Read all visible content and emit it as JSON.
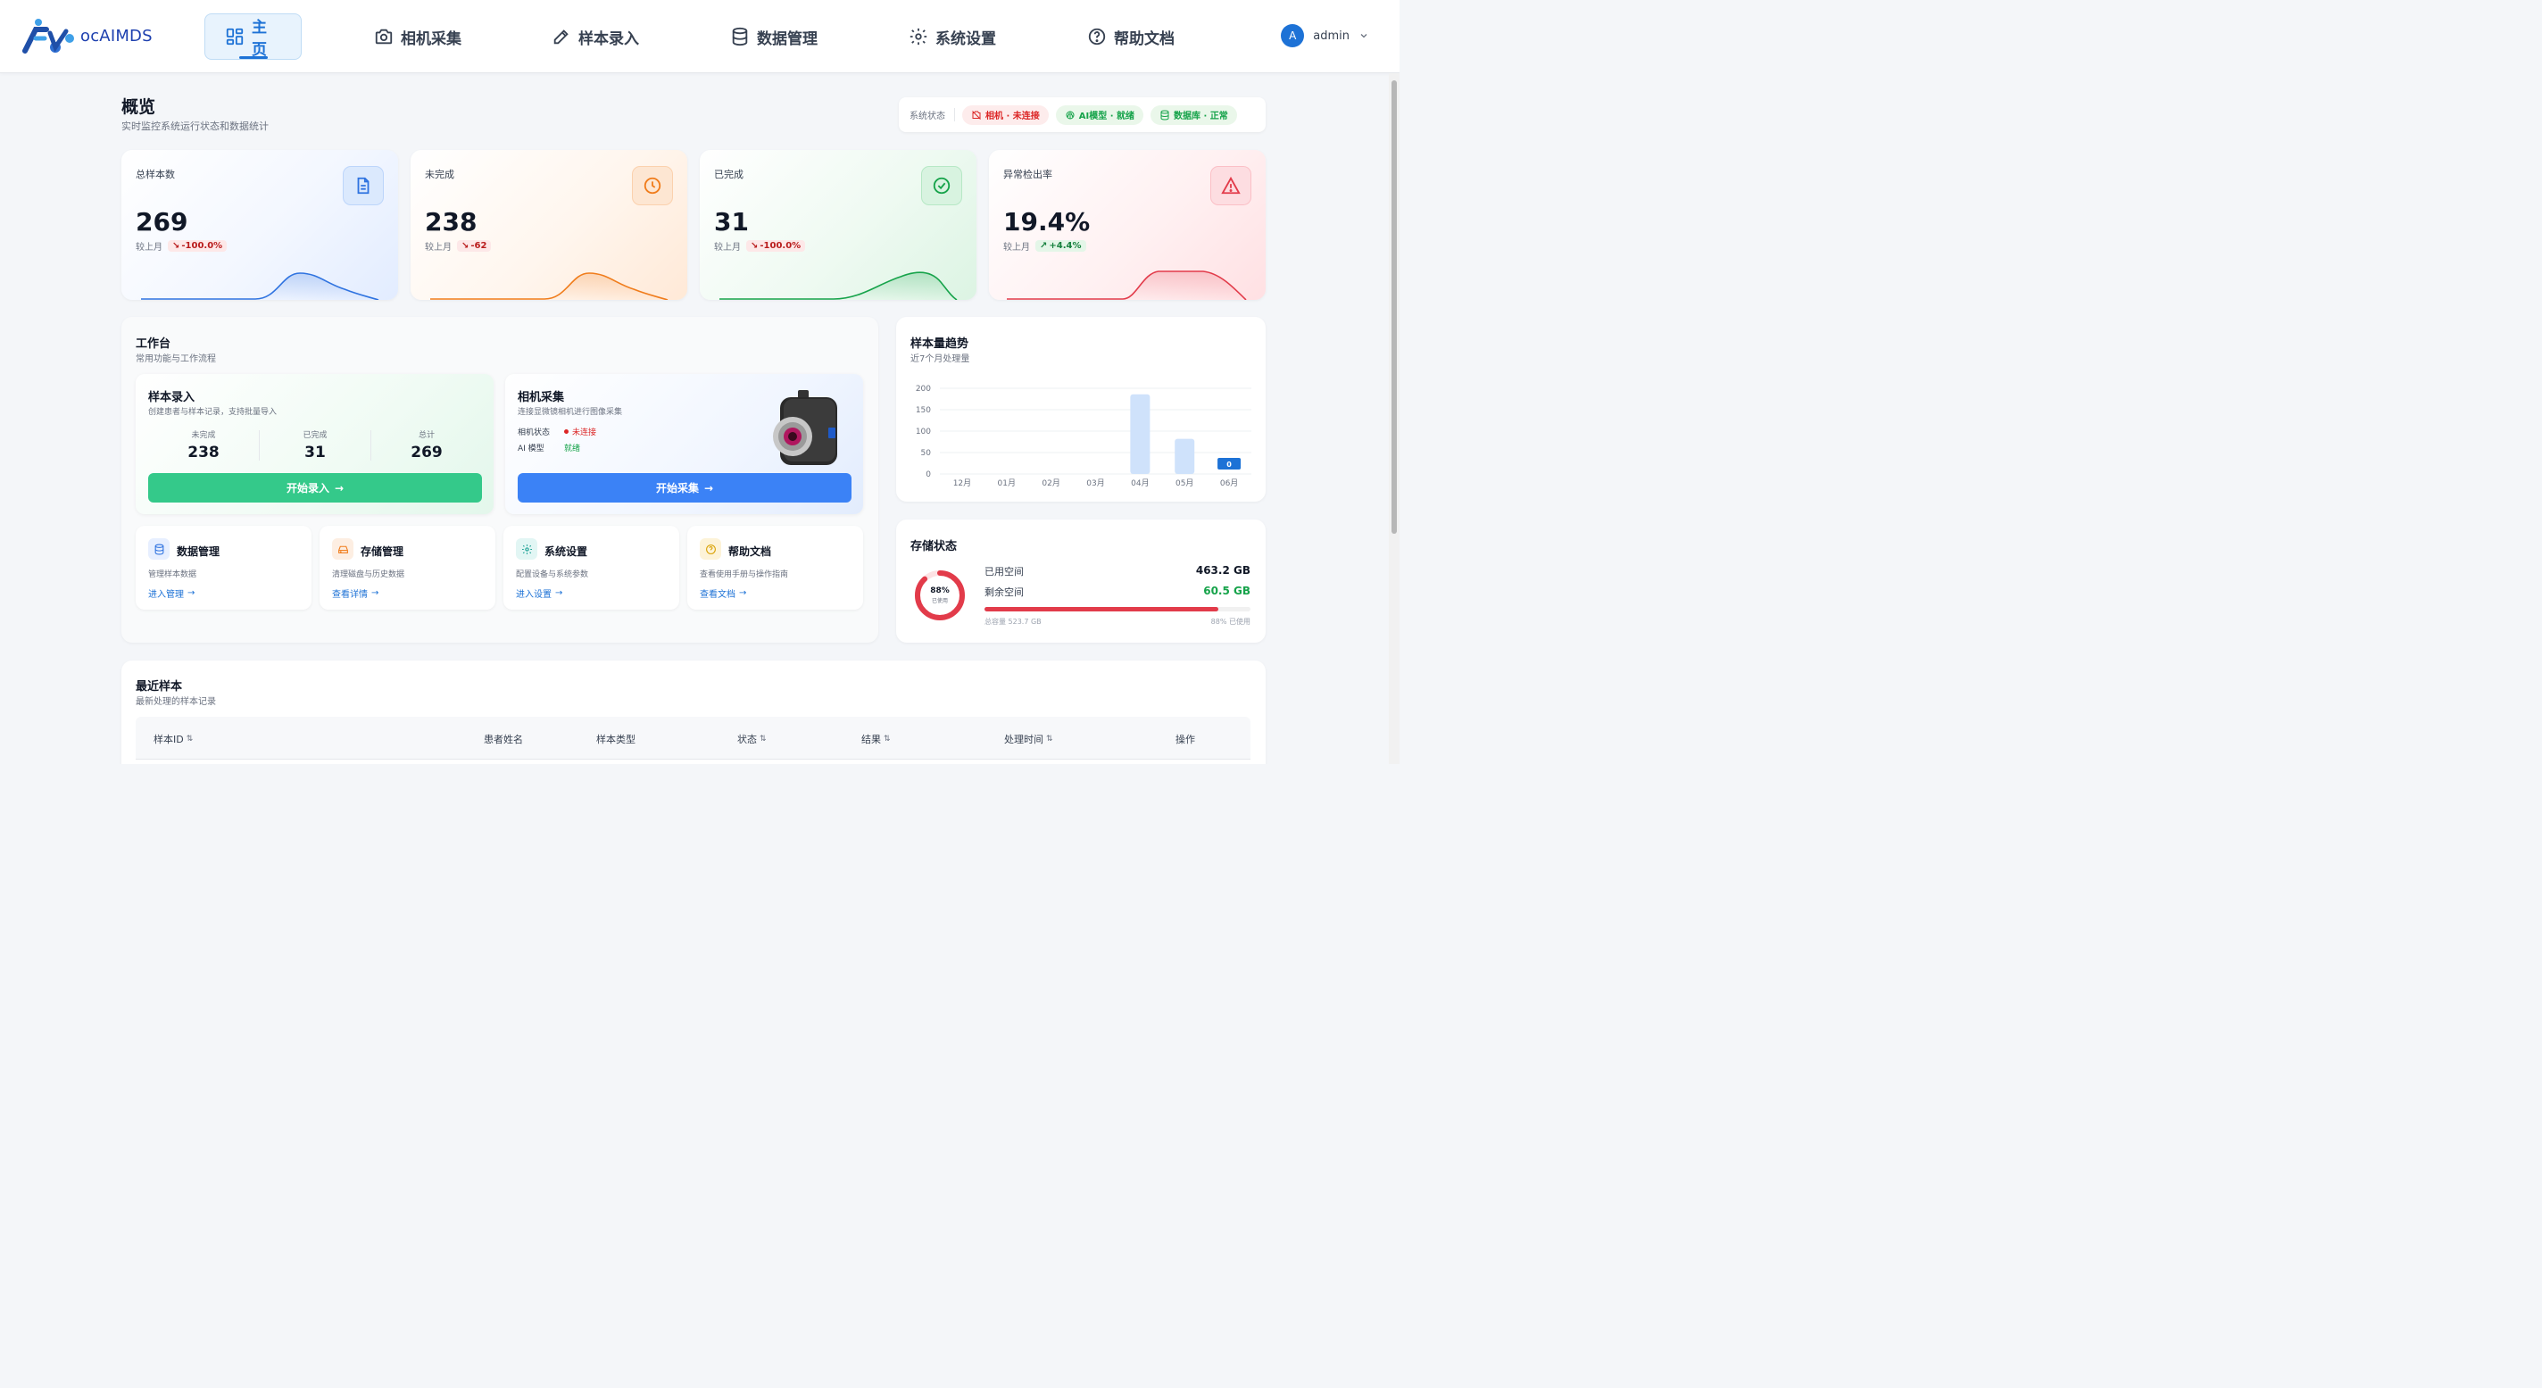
{
  "brand": {
    "logo_text": "ocAIMDS"
  },
  "nav": [
    {
      "label": "主页",
      "icon": "dashboard-icon",
      "active": true
    },
    {
      "label": "相机采集",
      "icon": "camera-icon",
      "active": false
    },
    {
      "label": "样本录入",
      "icon": "pen-icon",
      "active": false
    },
    {
      "label": "数据管理",
      "icon": "database-icon",
      "active": false
    },
    {
      "label": "系统设置",
      "icon": "gear-icon",
      "active": false
    },
    {
      "label": "帮助文档",
      "icon": "help-icon",
      "active": false
    }
  ],
  "user": {
    "avatar_letter": "A",
    "name": "admin"
  },
  "overview": {
    "title": "概览",
    "subtitle": "实时监控系统运行状态和数据统计"
  },
  "system_status": {
    "label": "系统状态",
    "camera": "相机 · 未连接",
    "ai": "AI模型 · 就绪",
    "db": "数据库 · 正常"
  },
  "stats": [
    {
      "label": "总样本数",
      "value": "269",
      "compare": "较上月",
      "trend": "-100.0%",
      "direction": "down",
      "color": "#2f73e0",
      "icon": "document-icon"
    },
    {
      "label": "未完成",
      "value": "238",
      "compare": "较上月",
      "trend": "-62",
      "direction": "down",
      "color": "#f07c1b",
      "icon": "clock-icon"
    },
    {
      "label": "已完成",
      "value": "31",
      "compare": "较上月",
      "trend": "-100.0%",
      "direction": "down",
      "color": "#16a34a",
      "icon": "check-circle-icon"
    },
    {
      "label": "异常检出率",
      "value": "19.4%",
      "compare": "较上月",
      "trend": "+4.4%",
      "direction": "up",
      "color": "#e23b4a",
      "icon": "warning-icon"
    }
  ],
  "workbench": {
    "title": "工作台",
    "subtitle": "常用功能与工作流程",
    "sample_entry": {
      "title": "样本录入",
      "desc": "创建患者与样本记录，支持批量导入",
      "stats": [
        {
          "label": "未完成",
          "value": "238"
        },
        {
          "label": "已完成",
          "value": "31"
        },
        {
          "label": "总计",
          "value": "269"
        }
      ],
      "button": "开始录入"
    },
    "camera": {
      "title": "相机采集",
      "desc": "连接显微镜相机进行图像采集",
      "camera_status_label": "相机状态",
      "camera_status_value": "未连接",
      "ai_label": "AI 模型",
      "ai_value": "就绪",
      "button": "开始采集"
    },
    "quick": [
      {
        "title": "数据管理",
        "desc": "管理样本数据",
        "link": "进入管理",
        "icon": "database-icon"
      },
      {
        "title": "存储管理",
        "desc": "清理磁盘与历史数据",
        "link": "查看详情",
        "icon": "drive-icon"
      },
      {
        "title": "系统设置",
        "desc": "配置设备与系统参数",
        "link": "进入设置",
        "icon": "gear-icon"
      },
      {
        "title": "帮助文档",
        "desc": "查看使用手册与操作指南",
        "link": "查看文档",
        "icon": "help-icon"
      }
    ]
  },
  "trend": {
    "title": "样本量趋势",
    "subtitle": "近7个月处理量",
    "badge_value": "0"
  },
  "chart_data": {
    "type": "bar",
    "categories": [
      "12月",
      "01月",
      "02月",
      "03月",
      "04月",
      "05月",
      "06月"
    ],
    "values": [
      0,
      0,
      0,
      0,
      186,
      82,
      0
    ],
    "yticks": [
      "0",
      "50",
      "100",
      "150",
      "200"
    ],
    "ylim": [
      0,
      200
    ],
    "grid": true
  },
  "storage": {
    "title": "存储状态",
    "used_label": "已用空间",
    "used_value": "463.2 GB",
    "free_label": "剩余空间",
    "free_value": "60.5 GB",
    "percent_text": "88%",
    "percent_sub": "已使用",
    "used_fraction": 0.88,
    "total_text": "总容量 523.7 GB",
    "used_text": "88% 已使用"
  },
  "recent": {
    "title": "最近样本",
    "subtitle": "最新处理的样本记录",
    "columns": [
      {
        "label": "样本ID",
        "sortable": true
      },
      {
        "label": "患者姓名",
        "sortable": false
      },
      {
        "label": "样本类型",
        "sortable": false
      },
      {
        "label": "状态",
        "sortable": true
      },
      {
        "label": "结果",
        "sortable": true
      },
      {
        "label": "处理时间",
        "sortable": true
      },
      {
        "label": "操作",
        "sortable": false
      }
    ]
  },
  "colors": {
    "accent": "#1d72d6",
    "green_btn": "#34c98a",
    "blue_btn": "#3b82f6",
    "danger": "#e23b4a"
  }
}
